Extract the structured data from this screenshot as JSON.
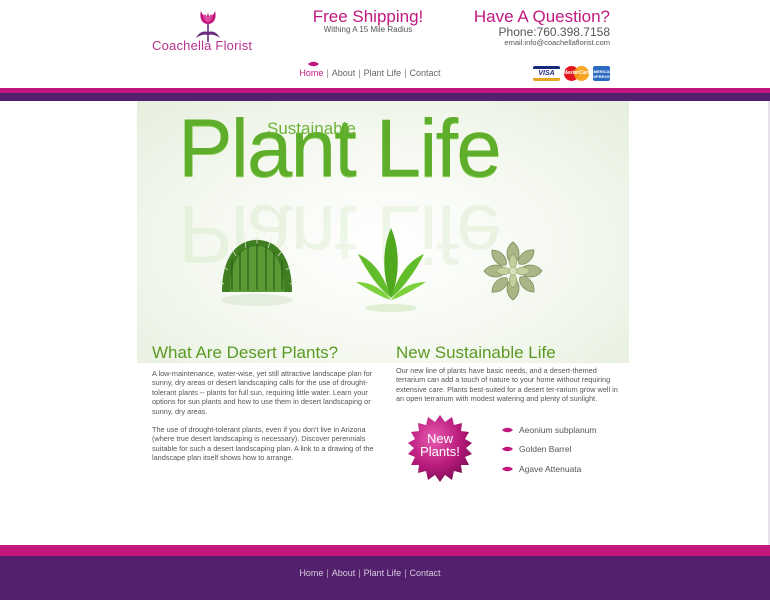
{
  "header": {
    "logo_text": "Coachella Florist",
    "shipping_title": "Free Shipping!",
    "shipping_sub": "Withing A 15 Mile Radius",
    "question_title": "Have A Question?",
    "phone": "Phone:760.398.7158",
    "email": "email:info@coachellaflorist.com"
  },
  "nav": {
    "items": [
      "Home",
      "About",
      "Plant Life",
      "Contact"
    ],
    "active": "Home"
  },
  "payment_cards": [
    "VISA",
    "MasterCard",
    "AMERICAN EXPRESS"
  ],
  "hero": {
    "subtitle": "Sustainable",
    "title": "Plant Life"
  },
  "desert": {
    "heading": "What Are Desert Plants?",
    "paragraph1": "A low-maintenance, water-wise, yet still attractive landscape plan for sunny, dry areas or desert landscaping calls for the use of drought-tolerant plants -- plants for full sun, requiring little water. Learn your options for sun plants and how to use them in desert landscaping or sunny, dry areas.",
    "paragraph2": "The use of drought-tolerant plants, even if you don't live in Arizona (where true desert landscaping is necessary). Discover perennials suitable for such a desert landscaping plan. A link to a drawing of the landscape plan itself shows how to arrange."
  },
  "sustainable": {
    "heading": "New Sustainable Life",
    "paragraph": "Our new line of plants have basic needs, and a desert-themed terrarium can add a touch of nature to your home without requiring extensive care. Plants best-suited for a desert ter-rarium grow well in an open terrarium with modest watering and plenty of sunlight.",
    "badge_line1": "New",
    "badge_line2": "Plants!",
    "plants": [
      "Aeonium subplanum",
      "Golden Barrel",
      "Agave Attenuata"
    ]
  },
  "footer": {
    "nav": [
      "Home",
      "About",
      "Plant Life",
      "Contact"
    ]
  },
  "colors": {
    "pink": "#c2177d",
    "purple": "#52206c",
    "green": "#5fae2b"
  }
}
